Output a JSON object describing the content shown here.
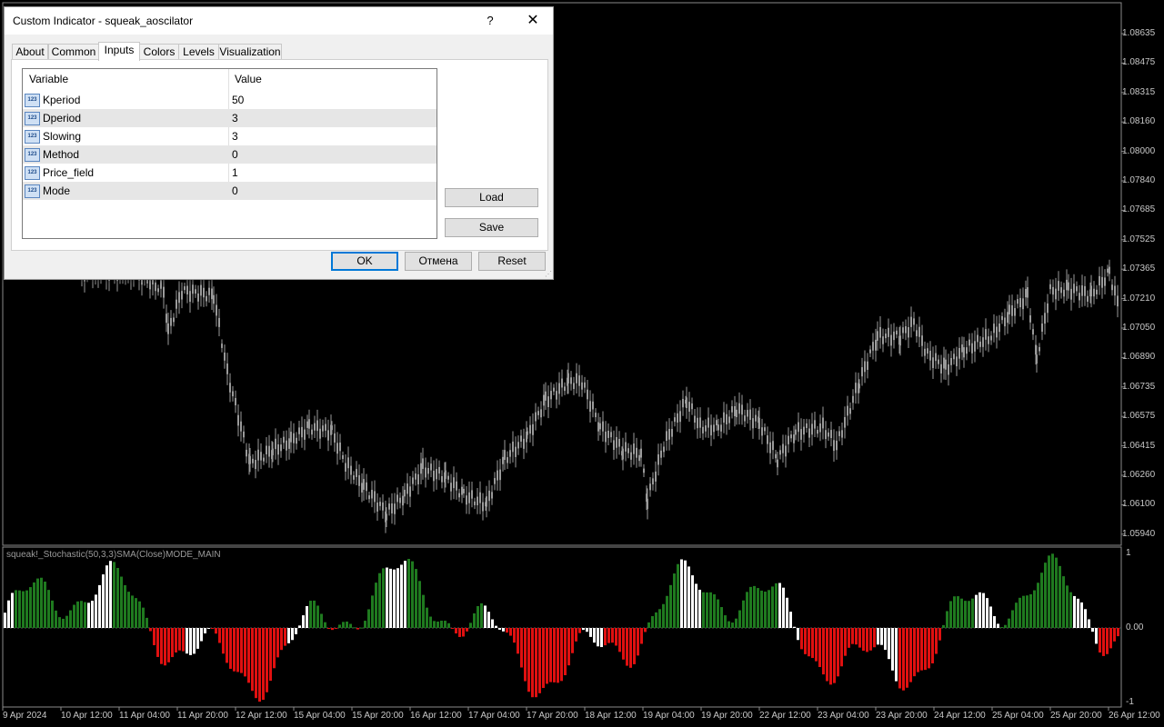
{
  "dialog": {
    "title": "Custom Indicator - squeak_aoscilator",
    "help_symbol": "?",
    "close_symbol": "✕",
    "tabs": [
      {
        "label": "About",
        "active": false
      },
      {
        "label": "Common",
        "active": false
      },
      {
        "label": "Inputs",
        "active": true
      },
      {
        "label": "Colors",
        "active": false
      },
      {
        "label": "Levels",
        "active": false
      },
      {
        "label": "Visualization",
        "active": false
      }
    ],
    "grid": {
      "col_variable": "Variable",
      "col_value": "Value",
      "row_icon_text": "123",
      "rows": [
        {
          "variable": "Kperiod",
          "value": "50"
        },
        {
          "variable": "Dperiod",
          "value": "3"
        },
        {
          "variable": "Slowing",
          "value": "3"
        },
        {
          "variable": "Method",
          "value": "0"
        },
        {
          "variable": "Price_field",
          "value": "1"
        },
        {
          "variable": "Mode",
          "value": "0"
        }
      ]
    },
    "load_label": "Load",
    "save_label": "Save",
    "ok_label": "OK",
    "cancel_label": "Отмена",
    "reset_label": "Reset"
  },
  "chart": {
    "price_labels": [
      "1.08635",
      "1.08475",
      "1.08315",
      "1.08160",
      "1.08000",
      "1.07840",
      "1.07685",
      "1.07525",
      "1.07365",
      "1.07210",
      "1.07050",
      "1.06890",
      "1.06735",
      "1.06575",
      "1.06415",
      "1.06260",
      "1.06100",
      "1.05940"
    ],
    "subwindow_title": "squeak!_Stochastic(50,3,3)SMA(Close)MODE_MAIN",
    "indicator_labels": [
      "1",
      "0.00",
      "-1"
    ],
    "time_labels": [
      "9 Apr 2024",
      "10 Apr 12:00",
      "11 Apr 04:00",
      "11 Apr 20:00",
      "12 Apr 12:00",
      "15 Apr 04:00",
      "15 Apr 20:00",
      "16 Apr 12:00",
      "17 Apr 04:00",
      "17 Apr 20:00",
      "18 Apr 12:00",
      "19 Apr 04:00",
      "19 Apr 20:00",
      "22 Apr 12:00",
      "23 Apr 04:00",
      "23 Apr 20:00",
      "24 Apr 12:00",
      "25 Apr 04:00",
      "25 Apr 20:00",
      "26 Apr 12:00"
    ],
    "colors": {
      "up": "#1f7a1f",
      "down": "#e01010",
      "neutral": "#ffffff",
      "candle": "#9a9a9a"
    }
  }
}
